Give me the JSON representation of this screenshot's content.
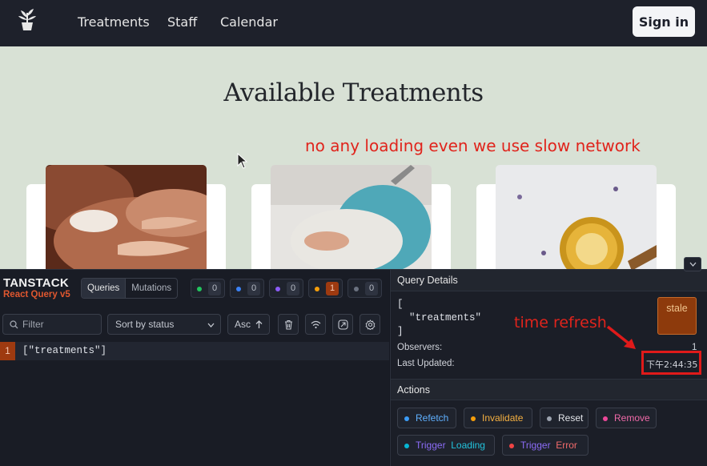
{
  "nav": {
    "links": [
      "Treatments",
      "Staff",
      "Calendar"
    ],
    "signin": "Sign in"
  },
  "main": {
    "title": "Available Treatments",
    "note": "no any loading even we use slow network"
  },
  "devtools": {
    "brand": "TANSTACK",
    "subbrand": "React Query v5",
    "tabs": [
      "Queries",
      "Mutations"
    ],
    "counts": [
      {
        "color": "#22c55e",
        "value": "0"
      },
      {
        "color": "#3b82f6",
        "value": "0"
      },
      {
        "color": "#8b5cf6",
        "value": "0"
      },
      {
        "color": "#f59e0b",
        "value": "1"
      },
      {
        "color": "#6b7280",
        "value": "0"
      }
    ],
    "filter_placeholder": "Filter",
    "sort_label": "Sort by status",
    "asc_label": "Asc",
    "query": {
      "count": "1",
      "key": "[\"treatments\"]"
    },
    "details": {
      "header": "Query Details",
      "key_lines": "[\n  \"treatments\"\n]",
      "status": "stale",
      "observers_label": "Observers:",
      "observers_value": "1",
      "updated_label": "Last Updated:",
      "updated_value": "下午2:44:35",
      "annotation": "time refresh"
    },
    "actions": {
      "header": "Actions",
      "refetch": "Refetch",
      "invalidate": "Invalidate",
      "reset": "Reset",
      "remove": "Remove",
      "trigger": "Trigger",
      "loading": "Loading",
      "error": "Error"
    }
  }
}
